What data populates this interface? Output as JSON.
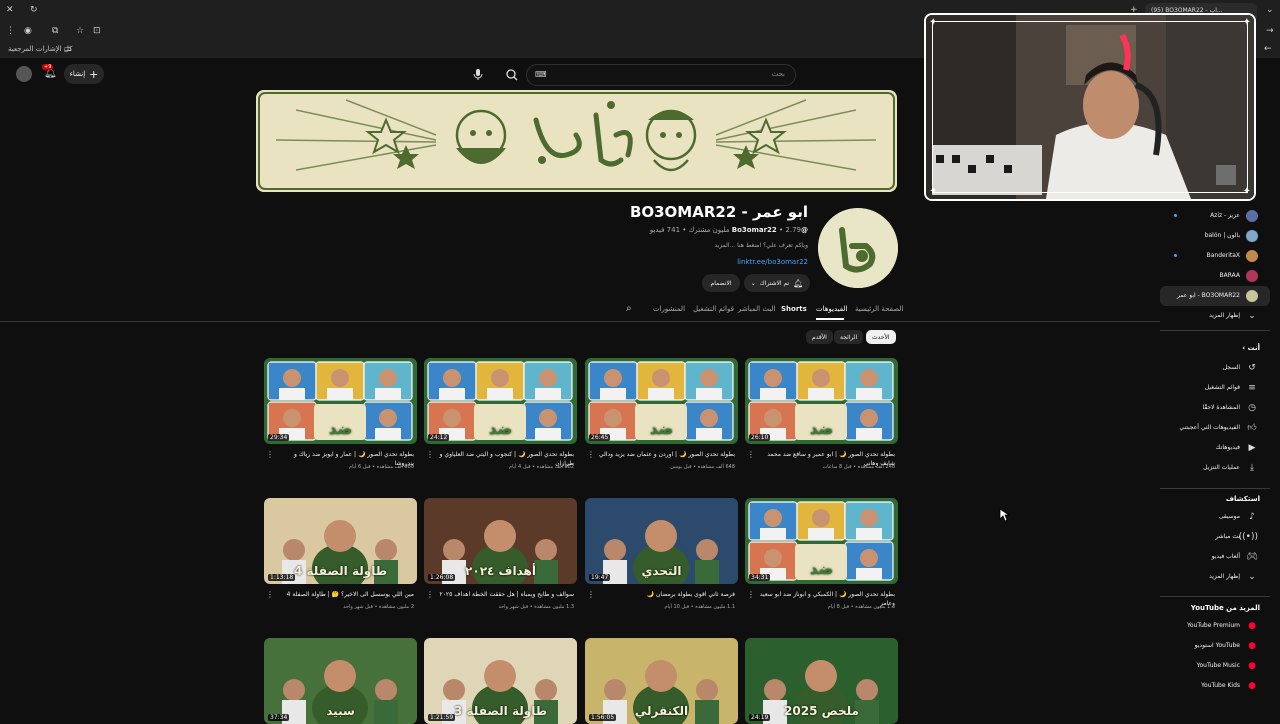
{
  "browser": {
    "tab_title": "(95) BO3OMAR22 - اب...",
    "bookmarks_label": "كل الإشارات المرجعية"
  },
  "masthead": {
    "notification_count": "+9",
    "create_label": "إنشاء",
    "search_placeholder": "بحث"
  },
  "channel": {
    "name": "BO3OMAR22 - ابو عمر",
    "handle": "@Bo3omar22",
    "meta": "2.79 مليون مشترك • 741 فيديو",
    "description": "وياكم تعرف علي؟ اضغط هنا ...المزيد",
    "link": "linktr.ee/bo3omar22",
    "subscribed_label": "تم الاشتراك",
    "join_label": "الانضمام"
  },
  "tabs": [
    {
      "label": "الصفحة الرئيسية"
    },
    {
      "label": "الفيديوهات"
    },
    {
      "label": "Shorts"
    },
    {
      "label": "البث المباشر"
    },
    {
      "label": "قوائم التشغيل"
    },
    {
      "label": "المنشورات"
    }
  ],
  "chips": [
    {
      "label": "الأحدث"
    },
    {
      "label": "الرائجة"
    },
    {
      "label": "الأقدم"
    }
  ],
  "videos": [
    {
      "duration": "26:10",
      "title": "بطولة تحدي الصور 🌙 | ابو عمير و سافع ضد محمد شايف وهاني",
      "meta": "248 ألف مشاهدة • قبل 8 ساعات"
    },
    {
      "duration": "26:45",
      "title": "بطولة تحدي الصور 🌙 | اوردن و عثمان ضد يزيد ودالي",
      "meta": "648 ألف مشاهدة • قبل يومين"
    },
    {
      "duration": "24:12",
      "title": "بطولة تحدي الصور 🌙 | كنجوب و اليتي ضد العلياوي و طرازان",
      "meta": "882 ألف مشاهدة • قبل 4 أيام"
    },
    {
      "duration": "29:34",
      "title": "بطولة تحدي الصور 🌙 | عمار و ايوبز ضد رياك و بندروشا",
      "meta": "988 ألف مشاهدة • قبل 6 أيام"
    },
    {
      "duration": "34:31",
      "title": "بطولة تحدي الصور 🌙 | الكمبكي و ابوناز ضد ابو سعيد وعامر",
      "meta": "1.3 مليون مشاهدة • قبل 8 أيام"
    },
    {
      "duration": "19:47",
      "title": "فرصة ثاني اقوى بطولة برمضان 🌙",
      "meta": "1.1 مليون مشاهدة • قبل 10 أيام"
    },
    {
      "duration": "1:26:08",
      "title": "سوالف و طايح ويمباه | هل حققت الخطة اهداف ٢٠٢٥",
      "meta": "1.3 مليون مشاهدة • قبل شهر واحد"
    },
    {
      "duration": "1:13:18",
      "title": "مين اللي يوسسل الى الاخير؟ 🤔 | طاولة الصفلة 4",
      "meta": "2 مليون مشاهدة • قبل شهر واحد"
    },
    {
      "duration": "24:19",
      "title": "",
      "meta": ""
    },
    {
      "duration": "1:56:05",
      "title": "",
      "meta": ""
    },
    {
      "duration": "1:21:59",
      "title": "",
      "meta": ""
    },
    {
      "duration": "37:34",
      "title": "",
      "meta": ""
    }
  ],
  "thumb_text": [
    "ضد",
    "ضد",
    "ضد",
    "ضد",
    "ضد",
    "التحدي",
    "أهداف ٢٠٢٤",
    "طاولة الصفلة 4",
    "ملخص 2025",
    "الكنقرلي",
    "طاولة الصفلة 3",
    "سبيد"
  ],
  "sidebar": {
    "subscriptions": [
      {
        "label": "عزيز - Aziz",
        "color": "#5a6ea8"
      },
      {
        "label": "بالون | balón",
        "color": "#7fa7c9"
      },
      {
        "label": "BanderitaX",
        "color": "#c4884a"
      },
      {
        "label": "BARAA",
        "color": "#b0375a"
      },
      {
        "label": "BO3OMAR22 - ابو عمر",
        "color": "#c9c59c"
      }
    ],
    "show_more": "إظهار المزيد",
    "you_header": "أنت",
    "you_items": [
      "السجل",
      "قوائم التشغيل",
      "المشاهدة لاحقًا",
      "الفيديوهات التي أعجبتني",
      "فيديوهاتك",
      "عمليات التنزيل"
    ],
    "explore_header": "استكشاف",
    "explore_items": [
      "موسيقى",
      "بث مباشر",
      "ألعاب فيديو",
      "إظهار المزيد"
    ],
    "more_header": "المزيد من YouTube",
    "more_items": [
      "YouTube Premium",
      "YouTube استوديو",
      "YouTube Music",
      "YouTube Kids"
    ]
  },
  "colors": {
    "bg": "#0f0f0f",
    "banner": "#e9e3c2",
    "banner_ink": "#4d6a2f",
    "link": "#3ea6ff",
    "yt_red": "#ff0033",
    "thumb_green": "#4c8a3a"
  }
}
